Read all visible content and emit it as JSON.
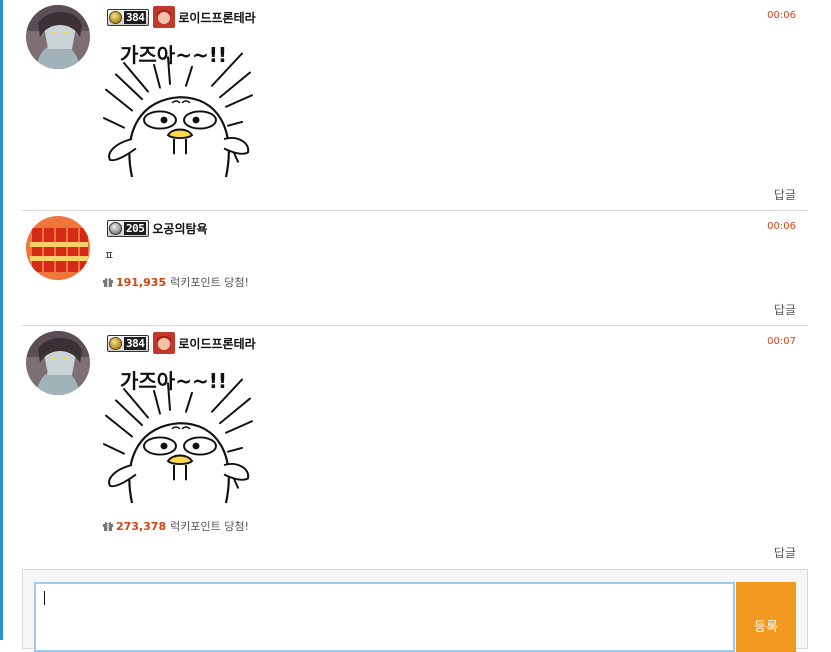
{
  "comments": [
    {
      "level": "384",
      "nickname": "로이드프론테라",
      "time": "00:06",
      "sticker_text": "가즈아~~!!",
      "reply_label": "답글"
    },
    {
      "level": "205",
      "nickname": "오공의탐욕",
      "time": "00:06",
      "text": "ㅍ",
      "lucky_points": "191,935",
      "lucky_label": "럭키포인트 당첨!",
      "reply_label": "답글"
    },
    {
      "level": "384",
      "nickname": "로이드프론테라",
      "time": "00:07",
      "sticker_text": "가즈아~~!!",
      "lucky_points": "273,378",
      "lucky_label": "럭키포인트 당첨!",
      "reply_label": "답글"
    }
  ],
  "editor": {
    "input_value": "",
    "submit_label": "등록"
  },
  "colors": {
    "accent": "#f19a1f",
    "time": "#d14514",
    "points": "#d14514",
    "left_edge": "#2a8fd8",
    "input_border": "#9ccbf0"
  },
  "icons": [
    "gift-icon",
    "level-medal-icon"
  ]
}
